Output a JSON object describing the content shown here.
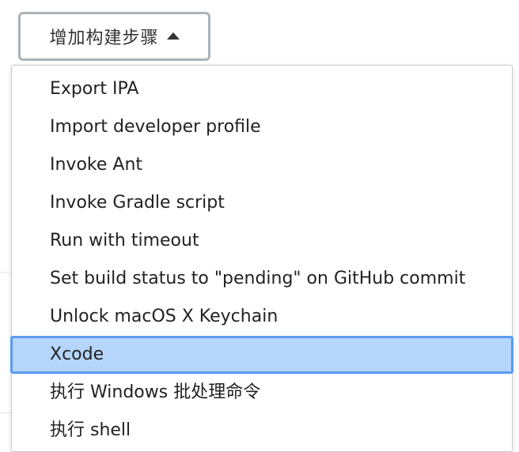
{
  "add_step_button": {
    "label": "增加构建步骤",
    "icon": "caret-up-icon"
  },
  "menu": {
    "items": [
      {
        "label": "Export IPA",
        "selected": false
      },
      {
        "label": "Import developer profile",
        "selected": false
      },
      {
        "label": "Invoke Ant",
        "selected": false
      },
      {
        "label": "Invoke Gradle script",
        "selected": false
      },
      {
        "label": "Run with timeout",
        "selected": false
      },
      {
        "label": "Set build status to \"pending\" on GitHub commit",
        "selected": false
      },
      {
        "label": "Unlock macOS X Keychain",
        "selected": false
      },
      {
        "label": "Xcode",
        "selected": true
      },
      {
        "label": "执行 Windows 批处理命令",
        "selected": false
      },
      {
        "label": "执行 shell",
        "selected": false
      }
    ]
  },
  "colors": {
    "selected_bg": "#b5d5fb",
    "selected_border": "#5b9bf2",
    "button_border": "#a9b3b8"
  }
}
